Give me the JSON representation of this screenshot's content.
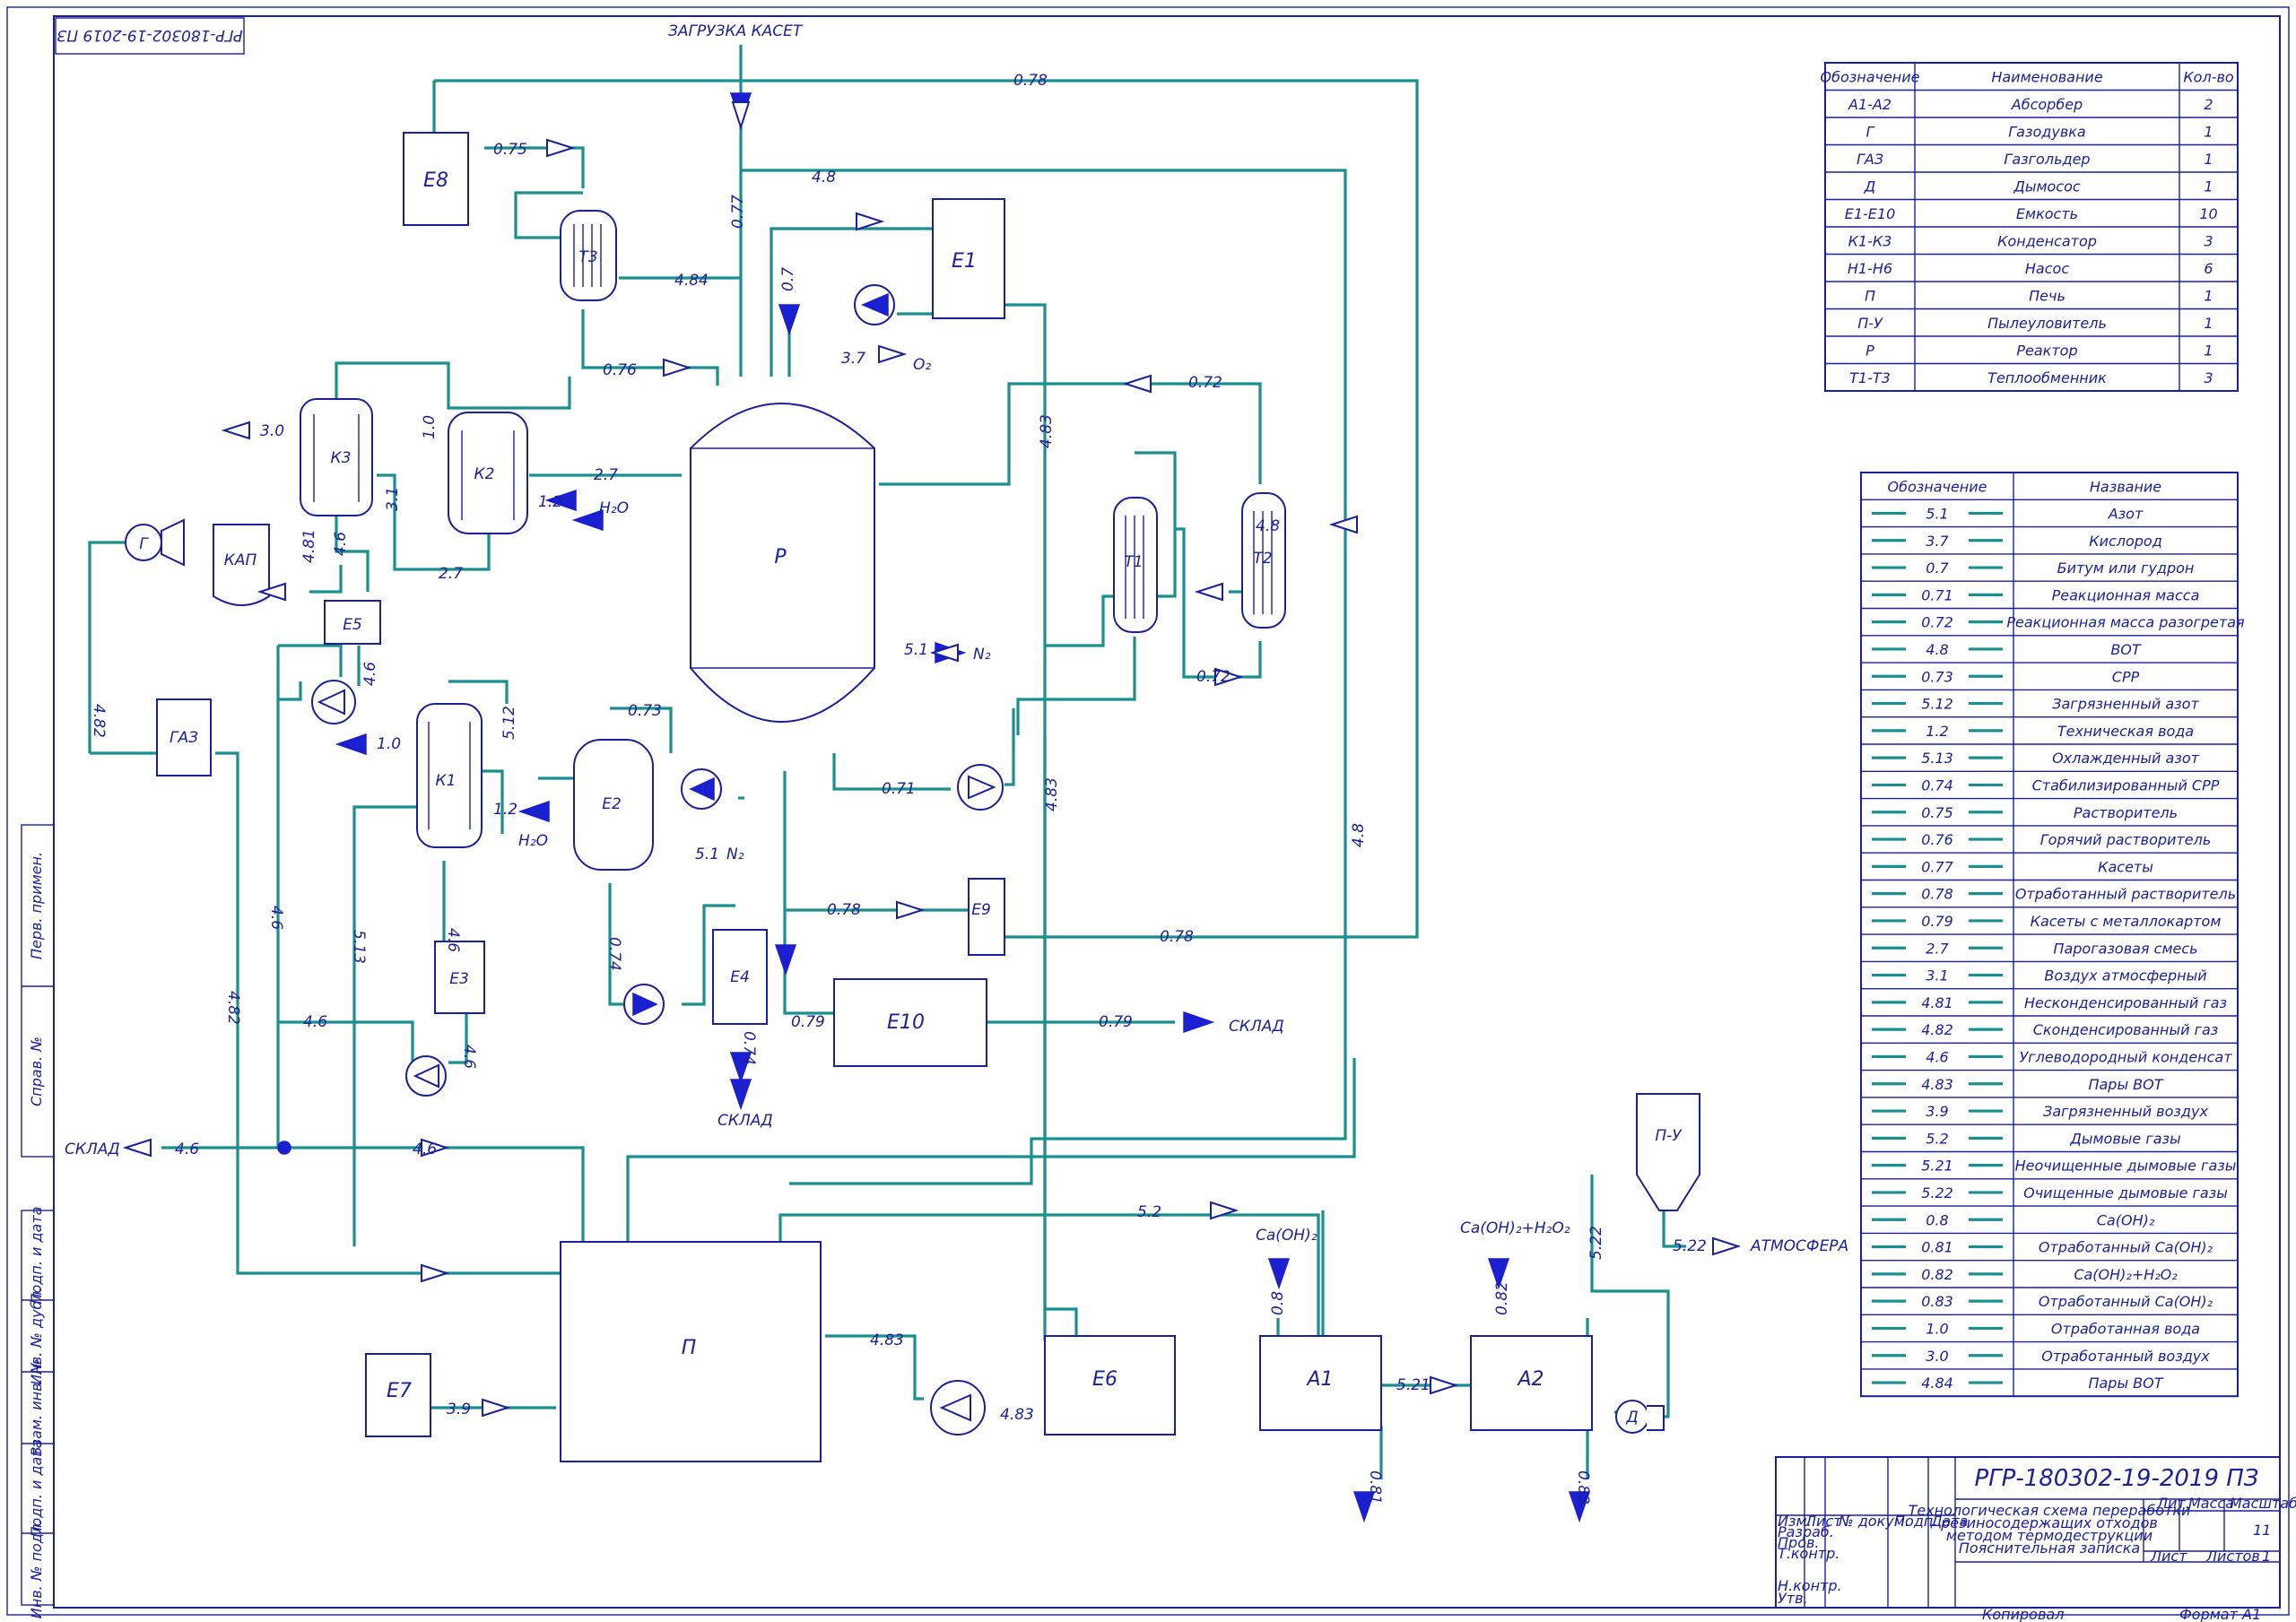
{
  "sheet": {
    "corner_stamp": "РГР-180302-19-2019 ПЗ",
    "doc_code": "РГР-180302-19-2019 ПЗ",
    "doc_title_lines": [
      "Технологическая схема переработки",
      "резиносодержащих отходов",
      "методом термодеструкции",
      "Пояснительная записка"
    ],
    "lit_label": "Лит.",
    "mass_label": "Масса",
    "scale_label": "Масштаб",
    "sheet_label": "Лист",
    "sheets_label": "Листов",
    "sheets_count": "1",
    "sheet_number": "11",
    "copied": "Копировал",
    "format": "Формат",
    "format_value": "А1",
    "stamp_rows": [
      "Изм.",
      "Лист",
      "№ докум.",
      "Подп.",
      "Дата"
    ],
    "stamp_roles": [
      "Разраб.",
      "Пров.",
      "Т.контр.",
      "",
      "Н.контр.",
      "Утв."
    ],
    "side_boxes": [
      "Перв. примен.",
      "Справ. №",
      "Подп. и дата",
      "Инв. № дубл.",
      "Взам. инв. №",
      "Подп. и дата",
      "Инв. № подл."
    ]
  },
  "equipment_table": {
    "headers": [
      "Обозначение",
      "Наименование",
      "Кол-во"
    ],
    "rows": [
      [
        "А1-А2",
        "Абсорбер",
        "2"
      ],
      [
        "Г",
        "Газодувка",
        "1"
      ],
      [
        "ГАЗ",
        "Газгольдер",
        "1"
      ],
      [
        "Д",
        "Дымосос",
        "1"
      ],
      [
        "Е1-Е10",
        "Емкость",
        "10"
      ],
      [
        "К1-К3",
        "Конденсатор",
        "3"
      ],
      [
        "Н1-Н6",
        "Насос",
        "6"
      ],
      [
        "П",
        "Печь",
        "1"
      ],
      [
        "П-У",
        "Пылеуловитель",
        "1"
      ],
      [
        "Р",
        "Реактор",
        "1"
      ],
      [
        "Т1-Т3",
        "Теплообменник",
        "3"
      ]
    ]
  },
  "stream_table": {
    "headers": [
      "Обозначение",
      "Название"
    ],
    "rows": [
      [
        "5.1",
        "Азот"
      ],
      [
        "3.7",
        "Кислород"
      ],
      [
        "0.7",
        "Битум или гудрон"
      ],
      [
        "0.71",
        "Реакционная масса"
      ],
      [
        "0.72",
        "Реакционная масса разогретая"
      ],
      [
        "4.8",
        "ВОТ"
      ],
      [
        "0.73",
        "СРР"
      ],
      [
        "5.12",
        "Загрязненный азот"
      ],
      [
        "1.2",
        "Техническая вода"
      ],
      [
        "5.13",
        "Охлажденный азот"
      ],
      [
        "0.74",
        "Стабилизированный СРР"
      ],
      [
        "0.75",
        "Растворитель"
      ],
      [
        "0.76",
        "Горячий растворитель"
      ],
      [
        "0.77",
        "Касеты"
      ],
      [
        "0.78",
        "Отработанный растворитель"
      ],
      [
        "0.79",
        "Касеты с металлокартом"
      ],
      [
        "2.7",
        "Парогазовая смесь"
      ],
      [
        "3.1",
        "Воздух атмосферный"
      ],
      [
        "4.81",
        "Несконденсированный газ"
      ],
      [
        "4.82",
        "Сконденсированный газ"
      ],
      [
        "4.6",
        "Углеводородный конденсат"
      ],
      [
        "4.83",
        "Пары ВОТ"
      ],
      [
        "3.9",
        "Загрязненный воздух"
      ],
      [
        "5.2",
        "Дымовые газы"
      ],
      [
        "5.21",
        "Неочищенные дымовые газы"
      ],
      [
        "5.22",
        "Очищенные дымовые газы"
      ],
      [
        "0.8",
        "Ca(OH)₂"
      ],
      [
        "0.81",
        "Отработанный Ca(OH)₂"
      ],
      [
        "0.82",
        "Ca(OH)₂+H₂O₂"
      ],
      [
        "0.83",
        "Отработанный Ca(OH)₂"
      ],
      [
        "1.0",
        "Отработанная вода"
      ],
      [
        "3.0",
        "Отработанный воздух"
      ],
      [
        "4.84",
        "Пары ВОТ"
      ]
    ]
  },
  "equipment": {
    "E8": "Е8",
    "T3": "Т3",
    "E1": "Е1",
    "K3": "К3",
    "K2": "К2",
    "G": "Г",
    "KAP": "КАП",
    "E5": "Е5",
    "GAZ": "ГАЗ",
    "K1": "К1",
    "E2": "Е2",
    "E3": "Е3",
    "R": "Р",
    "T1": "Т1",
    "T2": "Т2",
    "E9": "Е9",
    "E4": "Е4",
    "E10": "Е10",
    "P": "П",
    "E6": "Е6",
    "E7": "Е7",
    "A1": "А1",
    "A2": "А2",
    "PU": "П-У",
    "D": "Д"
  },
  "flow_text": {
    "cassette_load": "ЗАГРУЗКА КАСЕТ",
    "sklad": "СКЛАД",
    "atmosphere": "АТМОСФЕРА",
    "o2": "O₂",
    "n2": "N₂",
    "h2o": "H₂O",
    "caoh2": "Ca(OH)₂",
    "caoh2h2o2": "Ca(OH)₂+H₂O₂"
  },
  "stream_labels": {
    "s078": "0.78",
    "s48": "4.8",
    "s075": "0.75",
    "s077": "0.77",
    "s484": "4.84",
    "s07": "0.7",
    "s37": "3.7",
    "s076": "0.76",
    "s072": "0.72",
    "s30": "3.0",
    "s10": "1.0",
    "s27": "2.7",
    "s12": "1.2",
    "s31": "3.1",
    "s483": "4.83",
    "s481": "4.81",
    "s46": "4.6",
    "s482": "4.82",
    "s51": "5.1",
    "s073": "0.73",
    "s512": "5.12",
    "s071": "0.71",
    "s513": "5.13",
    "s074": "0.74",
    "s079": "0.79",
    "s52": "5.2",
    "s39": "3.9",
    "s08": "0.8",
    "s082": "0.82",
    "s521": "5.21",
    "s081": "0.81",
    "s083": "0.83",
    "s522": "5.22"
  }
}
